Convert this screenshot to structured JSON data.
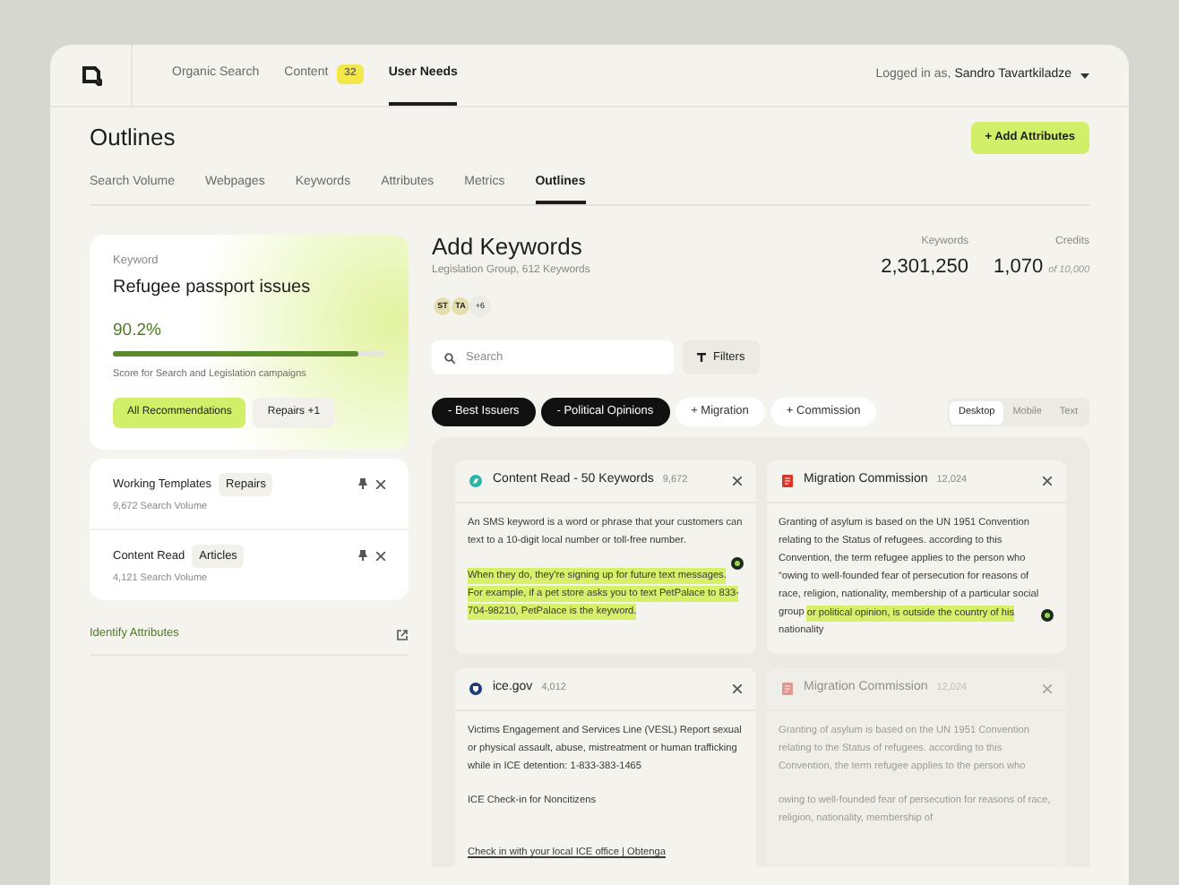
{
  "nav": {
    "items": [
      {
        "label": "Organic Search",
        "selected": false
      },
      {
        "label": "Content",
        "badge": "32",
        "selected": false
      },
      {
        "label": "User Needs",
        "selected": true
      }
    ],
    "login_label": "Logged in as,",
    "user": "Sandro Tavartkiladze"
  },
  "page": {
    "title": "Outlines",
    "action": "+ Add Attributes"
  },
  "tabs": [
    {
      "label": "Search Volume",
      "selected": false
    },
    {
      "label": "Webpages",
      "selected": false
    },
    {
      "label": "Keywords",
      "selected": false
    },
    {
      "label": "Attributes",
      "selected": false
    },
    {
      "label": "Metrics",
      "selected": false
    },
    {
      "label": "Outlines",
      "selected": true
    }
  ],
  "keyword_card": {
    "label": "Keyword",
    "title": "Refugee passport issues",
    "score": "90.2%",
    "level": 0.9,
    "caption": "Score for Search and Legislation campaigns",
    "buttons": [
      {
        "label": "All Recommendations",
        "selected": true
      },
      {
        "label": "Repairs +1",
        "selected": false
      }
    ]
  },
  "saved": [
    {
      "title": "Working Templates",
      "tag": "Repairs",
      "meta": "9,672 Search Volume"
    },
    {
      "title": "Content Read",
      "tag": "Articles",
      "meta": "4,121 Search Volume"
    }
  ],
  "identify_link": "Identify Attributes",
  "section": {
    "title": "Add Keywords",
    "subtitle": "Legislation Group, 612 Keywords",
    "avatars": [
      "ST",
      "TA"
    ],
    "more": "+6",
    "stats": [
      {
        "label": "Keywords",
        "value": "2,301,250"
      },
      {
        "label": "Credits",
        "value": "1,070",
        "suffix": "of 10,000"
      }
    ]
  },
  "search": {
    "placeholder": "Search"
  },
  "filters": "Filters",
  "chips": [
    {
      "label": "- Best Issuers",
      "selected": true
    },
    {
      "label": "- Political Opinions",
      "selected": true
    },
    {
      "label": "+ Migration",
      "selected": false
    },
    {
      "label": "+ Commission",
      "selected": false
    }
  ],
  "views": [
    {
      "label": "Desktop",
      "selected": true
    },
    {
      "label": "Mobile",
      "selected": false
    },
    {
      "label": "Text",
      "selected": false
    }
  ],
  "cards": [
    {
      "kind": "teal",
      "title": "Content Read - 50 Keywords",
      "count": "9,672",
      "disabled": false,
      "paragraphs": [
        [
          {
            "text": "An SMS keyword is a word or phrase that your customers can text to a 10-digit local number or toll-free number.",
            "highlighted": false
          }
        ],
        [
          {
            "text": "When they do, they're signing up for future text messages. For example, if a pet store asks you to text PetPalace to 833-704-98210, PetPalace is the keyword.",
            "highlighted": true
          }
        ]
      ]
    },
    {
      "kind": "red",
      "title": "Migration Commission",
      "count": "12,024",
      "disabled": false,
      "paragraphs": [
        [
          {
            "text": "Granting of asylum is based on the UN 1951 Convention relating to the Status of refugees. according to this Convention, the term refugee applies to the person who “owing to well-founded fear of persecution for reasons of race, religion, nationality, membership of a particular social group ",
            "highlighted": false
          },
          {
            "text": "or political opinion, is outside the country of his",
            "highlighted": true
          },
          {
            "text": " nationality",
            "highlighted": false
          }
        ]
      ]
    },
    {
      "kind": "navy",
      "title": "ice.gov",
      "count": "4,012",
      "disabled": false,
      "paragraphs": [
        [
          {
            "text": "Victims Engagement and Services Line (VESL) Report sexual or physical assault, abuse, mistreatment or human trafficking while in ICE detention: 1-833-383-1465",
            "highlighted": false
          }
        ],
        [
          {
            "text": "ICE Check-in for Noncitizens",
            "highlighted": false
          }
        ],
        [
          {
            "text": "Check in with your local ICE office | Obtenga",
            "link": true,
            "highlighted": false
          }
        ]
      ]
    },
    {
      "kind": "red",
      "title": "Migration Commission",
      "count": "12,024",
      "disabled": true,
      "paragraphs": [
        [
          {
            "text": "Granting of asylum is based on the UN 1951 Convention relating to the Status of refugees. according to this Convention, the term refugee applies to the person who",
            "highlighted": false
          }
        ],
        [
          {
            "text": "owing to well-founded fear of persecution for reasons of race, religion, nationality, membership of",
            "highlighted": false
          }
        ]
      ]
    }
  ]
}
